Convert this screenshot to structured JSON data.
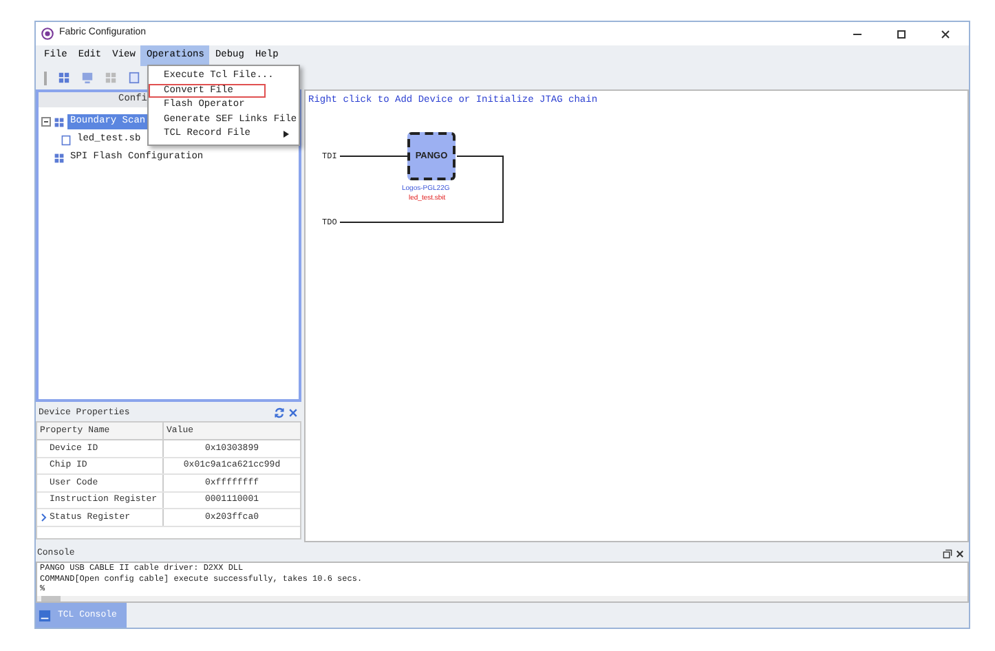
{
  "window": {
    "title": "Fabric Configuration"
  },
  "menu_bar": [
    {
      "label": "File",
      "selected": false
    },
    {
      "label": "Edit",
      "selected": false
    },
    {
      "label": "View",
      "selected": false
    },
    {
      "label": "Operations",
      "selected": true
    },
    {
      "label": "Debug",
      "selected": false
    },
    {
      "label": "Help",
      "selected": false
    }
  ],
  "operations_menu": [
    {
      "label": "Execute Tcl File...",
      "highlighted": false,
      "submenu": false
    },
    {
      "label": "Convert File",
      "highlighted": true,
      "submenu": false
    },
    {
      "label": "Flash Operator",
      "highlighted": false,
      "submenu": false
    },
    {
      "label": "Generate SEF Links File",
      "highlighted": false,
      "submenu": false
    },
    {
      "label": "TCL Record File",
      "highlighted": false,
      "submenu": true
    }
  ],
  "config_panel": {
    "title": "Confi",
    "tree": [
      {
        "label": "Boundary Scan",
        "selected": true,
        "expanded": true,
        "children": [
          {
            "label": "led_test.sb",
            "selected": false
          }
        ]
      },
      {
        "label": "SPI Flash Configuration",
        "selected": false
      }
    ]
  },
  "device_properties": {
    "title": "Device Properties",
    "columns": [
      "Property Name",
      "Value"
    ],
    "rows": [
      {
        "name": "Device ID",
        "value": "0x10303899",
        "expandable": false
      },
      {
        "name": "Chip ID",
        "value": "0x01c9a1ca621cc99d",
        "expandable": false
      },
      {
        "name": "User Code",
        "value": "0xffffffff",
        "expandable": false
      },
      {
        "name": "Instruction Register",
        "value": "0001110001",
        "expandable": false
      },
      {
        "name": "Status Register",
        "value": "0x203ffca0",
        "expandable": true
      }
    ]
  },
  "canvas": {
    "hint": "Right click to Add Device or Initialize JTAG chain",
    "tdi": "TDI",
    "tdo": "TDO",
    "device": {
      "label": "PANGO",
      "part": "Logos-PGL22G",
      "file": "led_test.sbit"
    }
  },
  "console": {
    "title": "Console",
    "lines": [
      "PANGO USB CABLE II cable driver: D2XX DLL",
      "COMMAND[Open config cable] execute successfully, takes 10.6 secs.",
      "%"
    ],
    "tabs": [
      {
        "label": "TCL Console",
        "selected": true
      }
    ]
  }
}
